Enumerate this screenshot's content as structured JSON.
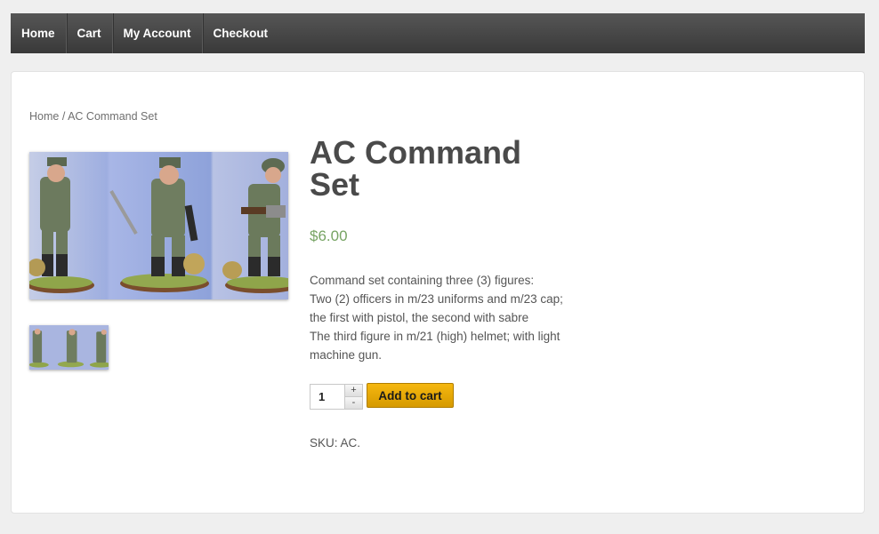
{
  "nav": {
    "items": [
      {
        "label": "Home"
      },
      {
        "label": "Cart"
      },
      {
        "label": "My Account"
      },
      {
        "label": "Checkout"
      }
    ]
  },
  "breadcrumb": {
    "home": "Home",
    "separator": " / ",
    "current": "AC Command Set"
  },
  "product": {
    "title": "AC Command Set",
    "price": "$6.00",
    "description": [
      "Command set containing three (3) figures:",
      "Two (2) officers in m/23 uniforms and m/23 cap; the first with pistol, the second with sabre",
      "The third figure in m/21 (high) helmet; with light machine gun."
    ],
    "quantity": "1",
    "qty_plus": "+",
    "qty_minus": "-",
    "add_to_cart": "Add to cart",
    "sku": "SKU: AC."
  },
  "colors": {
    "nav_bg": "#434343",
    "price": "#77a464",
    "button": "#e5a906"
  },
  "icons": {
    "main_image": "product-photo",
    "thumbnail": "product-thumbnail"
  }
}
